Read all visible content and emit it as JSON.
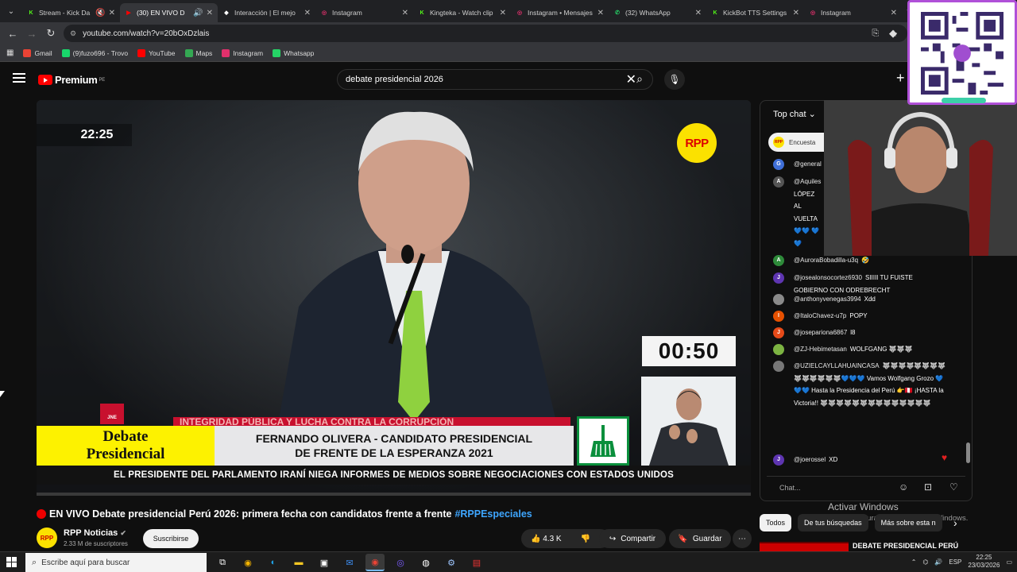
{
  "browser": {
    "tabs": [
      {
        "label": "Stream - Kick Da",
        "fav": "K",
        "favcolor": "#53fc18",
        "active": false,
        "muted": true
      },
      {
        "label": "(30) EN VIVO D",
        "fav": "▶",
        "favcolor": "#ff0000",
        "active": true,
        "audio": true
      },
      {
        "label": "Interacción | El mejo",
        "fav": "◆",
        "favcolor": "#ffffff",
        "active": false
      },
      {
        "label": "Instagram",
        "fav": "◎",
        "favcolor": "#e1306c",
        "active": false
      },
      {
        "label": "Kingteka - Watch clip",
        "fav": "K",
        "favcolor": "#53fc18",
        "active": false
      },
      {
        "label": "Instagram • Mensajes",
        "fav": "◎",
        "favcolor": "#e1306c",
        "active": false
      },
      {
        "label": "(32) WhatsApp",
        "fav": "✆",
        "favcolor": "#25d366",
        "active": false
      },
      {
        "label": "KickBot TTS Settings",
        "fav": "K",
        "favcolor": "#53fc18",
        "active": false
      },
      {
        "label": "Instagram",
        "fav": "◎",
        "favcolor": "#e1306c",
        "active": false
      }
    ],
    "url": "youtube.com/watch?v=20bOxDzlais",
    "bookmarks": [
      {
        "label": "Gmail",
        "color": "#ea4335"
      },
      {
        "label": "(9)fuzo696 - Trovo",
        "color": "#19d66b"
      },
      {
        "label": "YouTube",
        "color": "#ff0000"
      },
      {
        "label": "Maps",
        "color": "#34a853"
      },
      {
        "label": "Instagram",
        "color": "#e1306c"
      },
      {
        "label": "Whatsapp",
        "color": "#25d366"
      }
    ]
  },
  "youtube": {
    "logo_text": "Premium",
    "logo_sup": "PE",
    "search_value": "debate presidencial 2026"
  },
  "video": {
    "clock": "22:25",
    "channel_logo": "RPP",
    "countdown": "00:50",
    "jne": "JNE",
    "red_bar": "INTEGRIDAD PÚBLICA Y LUCHA CONTRA LA CORRUPCIÓN",
    "yellow_line1": "Debate",
    "yellow_line2": "Presidencial",
    "name_line1": "FERNANDO OLIVERA - CANDIDATO PRESIDENCIAL",
    "name_line2": "DE FRENTE DE LA ESPERANZA 2021",
    "ticker": "EL PRESIDENTE DEL PARLAMENTO IRANÍ NIEGA INFORMES DE MEDIOS SOBRE NEGOCIACIONES CON ESTADOS UNIDOS"
  },
  "meta": {
    "title": "EN VIVO Debate presidencial Perú 2026: primera fecha con candidatos frente a frente",
    "hashtag": "#RPPEspeciales",
    "channel_name": "RPP Noticias",
    "channel_avatar": "RPP",
    "subs": "2.33 M de suscriptores",
    "subscribe": "Suscribirse",
    "likes": "4.3 K",
    "share": "Compartir",
    "save": "Guardar"
  },
  "chat": {
    "header": "Top chat",
    "poll": "Encuesta",
    "input_placeholder": "Chat...",
    "messages": [
      {
        "av": "G",
        "color": "#3f6fd8",
        "author": "@general",
        "text": ""
      },
      {
        "av": "A",
        "color": "#555555",
        "author": "@Aquiles",
        "text": "INTELIGE LÓPEZ AL VUELTA 💙💙 💙💙"
      },
      {
        "av": "A",
        "color": "#2e8b3a",
        "author": "@AuroraBobadilla-u3q",
        "text": "🤣"
      },
      {
        "av": "J",
        "color": "#5e35b1",
        "author": "@josealonsocortez6930",
        "text": "SIIIII TU FUISTE GOBIERNO CON ODREBRECHT"
      },
      {
        "av": "",
        "color": "#8a8a8a",
        "author": "@anthonyvenegas3994",
        "text": "Xdd"
      },
      {
        "av": "I",
        "color": "#e65100",
        "author": "@ItaloChavez-u7p",
        "text": "POPY"
      },
      {
        "av": "J",
        "color": "#e64a19",
        "author": "@josepariona6867",
        "text": "l8"
      },
      {
        "av": "",
        "color": "#7cb342",
        "author": "@ZJ-Hebimetasan",
        "text": "WOLFGANG 🐺🐺🐺"
      },
      {
        "av": "",
        "color": "#777777",
        "author": "@UZIELCAYLLAHUAINCASA",
        "text": "🐺🐺🐺🐺🐺🐺🐺🐺🐺🐺🐺🐺🐺🐺💙💙💙 Vamos Wolfgang Grozo 💙💙💙 Hasta la Presidencia del Perú 👉🇵🇪 ¡HASTA la Victoria!! 🐺🐺🐺🐺🐺🐺🐺🐺🐺🐺🐺🐺🐺🐺"
      },
      {
        "av": "J",
        "color": "#5e35b1",
        "author": "@joerossel",
        "text": "XD"
      }
    ]
  },
  "sidebar": {
    "activate": "Activar Windows",
    "activate_sub": "Ve a Configuración para activar Windows.",
    "chips": [
      "Todos",
      "De tus búsquedas",
      "Más sobre esta n"
    ],
    "related_title": "DEBATE PRESIDENCIAL PERÚ"
  },
  "taskbar": {
    "search": "Escribe aquí para buscar",
    "lang": "ESP",
    "time": "22:25",
    "date": "23/03/2026"
  }
}
